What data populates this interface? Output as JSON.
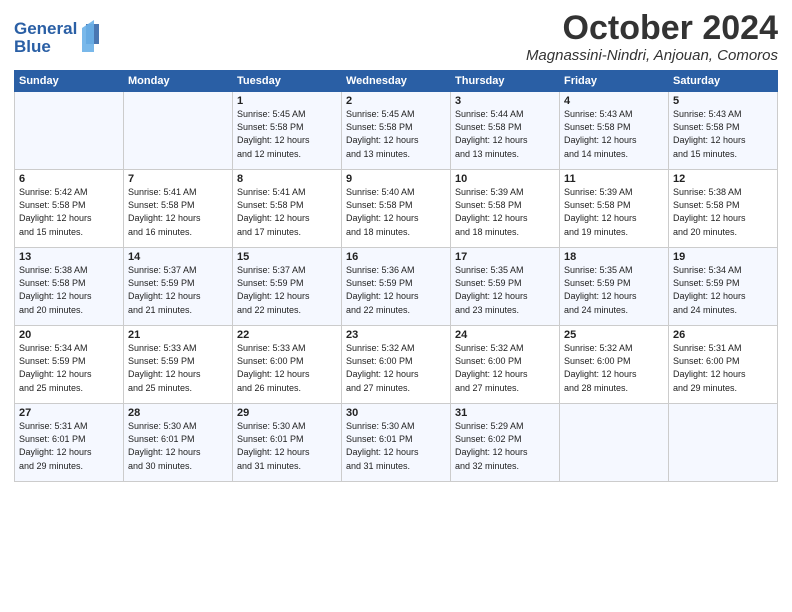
{
  "logo": {
    "line1": "General",
    "line2": "Blue"
  },
  "title": "October 2024",
  "location": "Magnassini-Nindri, Anjouan, Comoros",
  "headers": [
    "Sunday",
    "Monday",
    "Tuesday",
    "Wednesday",
    "Thursday",
    "Friday",
    "Saturday"
  ],
  "weeks": [
    [
      {
        "day": "",
        "info": ""
      },
      {
        "day": "",
        "info": ""
      },
      {
        "day": "1",
        "info": "Sunrise: 5:45 AM\nSunset: 5:58 PM\nDaylight: 12 hours\nand 12 minutes."
      },
      {
        "day": "2",
        "info": "Sunrise: 5:45 AM\nSunset: 5:58 PM\nDaylight: 12 hours\nand 13 minutes."
      },
      {
        "day": "3",
        "info": "Sunrise: 5:44 AM\nSunset: 5:58 PM\nDaylight: 12 hours\nand 13 minutes."
      },
      {
        "day": "4",
        "info": "Sunrise: 5:43 AM\nSunset: 5:58 PM\nDaylight: 12 hours\nand 14 minutes."
      },
      {
        "day": "5",
        "info": "Sunrise: 5:43 AM\nSunset: 5:58 PM\nDaylight: 12 hours\nand 15 minutes."
      }
    ],
    [
      {
        "day": "6",
        "info": "Sunrise: 5:42 AM\nSunset: 5:58 PM\nDaylight: 12 hours\nand 15 minutes."
      },
      {
        "day": "7",
        "info": "Sunrise: 5:41 AM\nSunset: 5:58 PM\nDaylight: 12 hours\nand 16 minutes."
      },
      {
        "day": "8",
        "info": "Sunrise: 5:41 AM\nSunset: 5:58 PM\nDaylight: 12 hours\nand 17 minutes."
      },
      {
        "day": "9",
        "info": "Sunrise: 5:40 AM\nSunset: 5:58 PM\nDaylight: 12 hours\nand 18 minutes."
      },
      {
        "day": "10",
        "info": "Sunrise: 5:39 AM\nSunset: 5:58 PM\nDaylight: 12 hours\nand 18 minutes."
      },
      {
        "day": "11",
        "info": "Sunrise: 5:39 AM\nSunset: 5:58 PM\nDaylight: 12 hours\nand 19 minutes."
      },
      {
        "day": "12",
        "info": "Sunrise: 5:38 AM\nSunset: 5:58 PM\nDaylight: 12 hours\nand 20 minutes."
      }
    ],
    [
      {
        "day": "13",
        "info": "Sunrise: 5:38 AM\nSunset: 5:58 PM\nDaylight: 12 hours\nand 20 minutes."
      },
      {
        "day": "14",
        "info": "Sunrise: 5:37 AM\nSunset: 5:59 PM\nDaylight: 12 hours\nand 21 minutes."
      },
      {
        "day": "15",
        "info": "Sunrise: 5:37 AM\nSunset: 5:59 PM\nDaylight: 12 hours\nand 22 minutes."
      },
      {
        "day": "16",
        "info": "Sunrise: 5:36 AM\nSunset: 5:59 PM\nDaylight: 12 hours\nand 22 minutes."
      },
      {
        "day": "17",
        "info": "Sunrise: 5:35 AM\nSunset: 5:59 PM\nDaylight: 12 hours\nand 23 minutes."
      },
      {
        "day": "18",
        "info": "Sunrise: 5:35 AM\nSunset: 5:59 PM\nDaylight: 12 hours\nand 24 minutes."
      },
      {
        "day": "19",
        "info": "Sunrise: 5:34 AM\nSunset: 5:59 PM\nDaylight: 12 hours\nand 24 minutes."
      }
    ],
    [
      {
        "day": "20",
        "info": "Sunrise: 5:34 AM\nSunset: 5:59 PM\nDaylight: 12 hours\nand 25 minutes."
      },
      {
        "day": "21",
        "info": "Sunrise: 5:33 AM\nSunset: 5:59 PM\nDaylight: 12 hours\nand 25 minutes."
      },
      {
        "day": "22",
        "info": "Sunrise: 5:33 AM\nSunset: 6:00 PM\nDaylight: 12 hours\nand 26 minutes."
      },
      {
        "day": "23",
        "info": "Sunrise: 5:32 AM\nSunset: 6:00 PM\nDaylight: 12 hours\nand 27 minutes."
      },
      {
        "day": "24",
        "info": "Sunrise: 5:32 AM\nSunset: 6:00 PM\nDaylight: 12 hours\nand 27 minutes."
      },
      {
        "day": "25",
        "info": "Sunrise: 5:32 AM\nSunset: 6:00 PM\nDaylight: 12 hours\nand 28 minutes."
      },
      {
        "day": "26",
        "info": "Sunrise: 5:31 AM\nSunset: 6:00 PM\nDaylight: 12 hours\nand 29 minutes."
      }
    ],
    [
      {
        "day": "27",
        "info": "Sunrise: 5:31 AM\nSunset: 6:01 PM\nDaylight: 12 hours\nand 29 minutes."
      },
      {
        "day": "28",
        "info": "Sunrise: 5:30 AM\nSunset: 6:01 PM\nDaylight: 12 hours\nand 30 minutes."
      },
      {
        "day": "29",
        "info": "Sunrise: 5:30 AM\nSunset: 6:01 PM\nDaylight: 12 hours\nand 31 minutes."
      },
      {
        "day": "30",
        "info": "Sunrise: 5:30 AM\nSunset: 6:01 PM\nDaylight: 12 hours\nand 31 minutes."
      },
      {
        "day": "31",
        "info": "Sunrise: 5:29 AM\nSunset: 6:02 PM\nDaylight: 12 hours\nand 32 minutes."
      },
      {
        "day": "",
        "info": ""
      },
      {
        "day": "",
        "info": ""
      }
    ]
  ]
}
